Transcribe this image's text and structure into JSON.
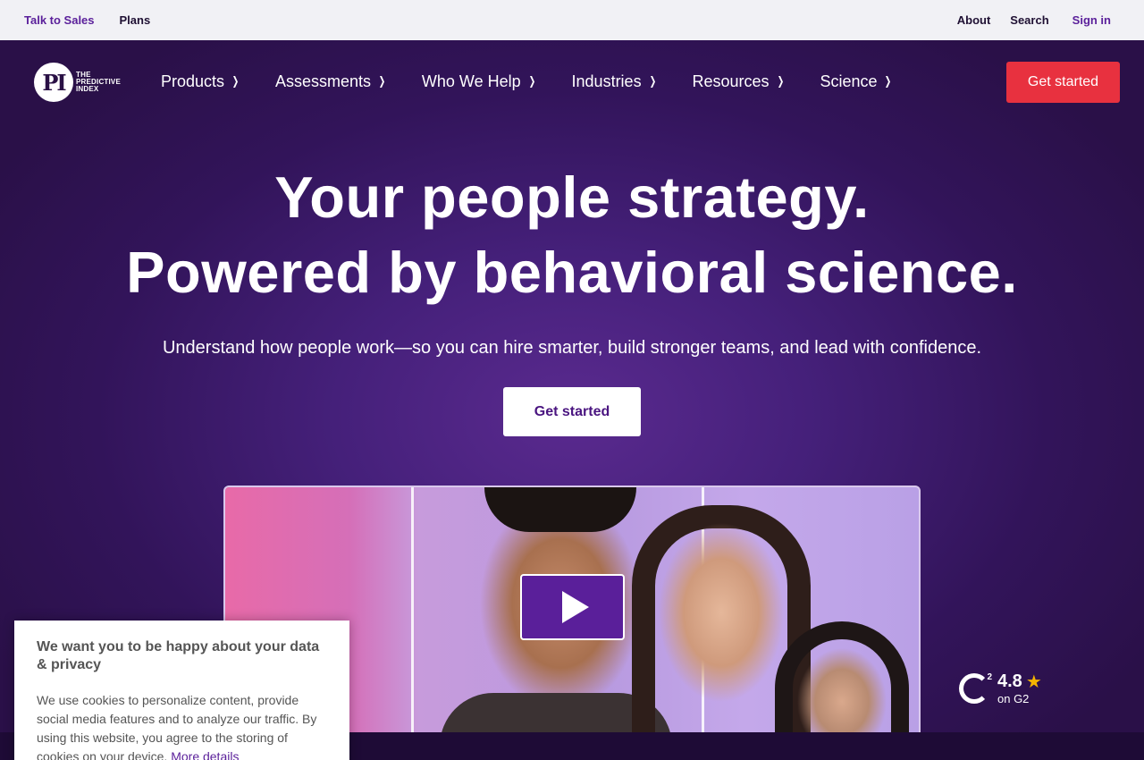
{
  "topbar": {
    "left_links": [
      "Talk to Sales",
      "Plans"
    ],
    "right_links": [
      "About",
      "Search",
      "Sign in"
    ]
  },
  "nav": {
    "logo_text": [
      "THE",
      "PREDICTIVE",
      "INDEX"
    ],
    "logo_mark": "PI",
    "items": [
      "Products",
      "Assessments",
      "Who We Help",
      "Industries",
      "Resources",
      "Science"
    ],
    "cta": "Get started"
  },
  "hero": {
    "headline_1": "Your people strategy.",
    "headline_2": "Powered by behavioral science.",
    "subhead": "Understand how people work—so you can hire smarter, build stronger teams, and lead with confidence.",
    "cta": "Get started"
  },
  "g2": {
    "score": "4.8",
    "label": "on G2",
    "sup": "2"
  },
  "cookie": {
    "title": "We want you to be happy about your data & privacy",
    "body": "We use cookies to personalize content, provide social media features and to analyze our traffic. By using this website, you agree to the storing of cookies on your device.",
    "link": "More details"
  },
  "colors": {
    "accent_red": "#e8313f",
    "brand_purple": "#5a1f9a",
    "hero_bg": "#3a1866"
  }
}
